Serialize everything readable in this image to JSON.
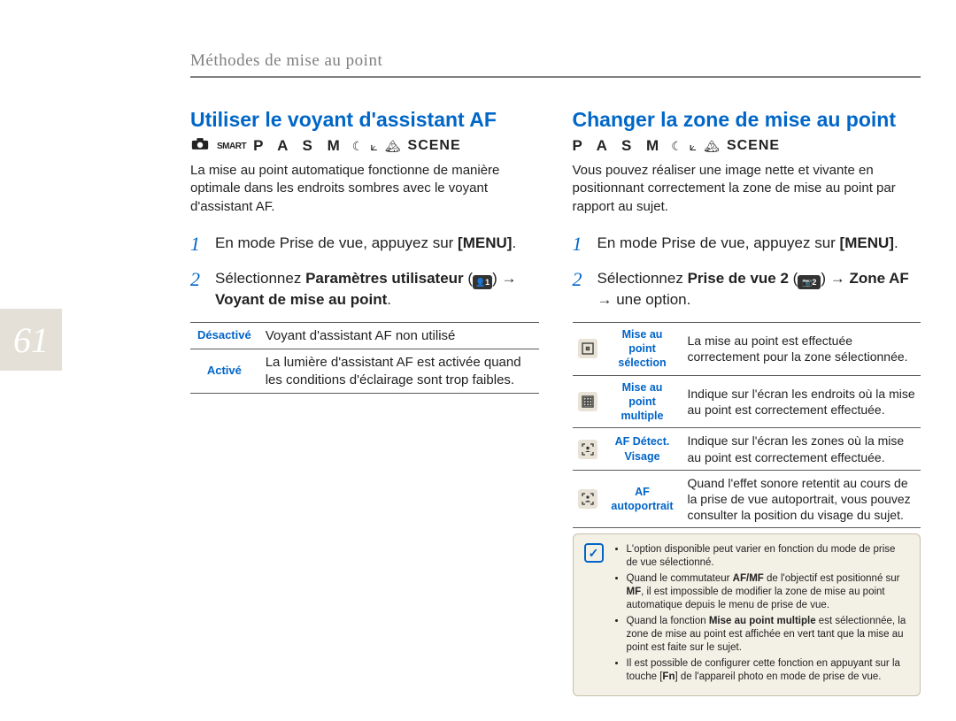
{
  "page_number": "61",
  "header_title": "Méthodes de mise au point",
  "left": {
    "title": "Utiliser le voyant d'assistant AF",
    "modes": {
      "smart": "SMART",
      "pasm": "P A S M",
      "scene": "SCENE"
    },
    "intro": "La mise au point automatique fonctionne de manière optimale dans les endroits sombres avec le voyant d'assistant AF.",
    "steps": [
      {
        "num": "1",
        "text_pre": "En mode Prise de vue, appuyez sur ",
        "menu": "[MENU]",
        "text_post": "."
      },
      {
        "num": "2",
        "text_pre": "Sélectionnez ",
        "bold1": "Paramètres utilisateur",
        "icon1": "1",
        "mid": " → ",
        "bold2": "Voyant de mise au point",
        "text_post": "."
      }
    ],
    "table": [
      {
        "opt": "Désactivé",
        "desc": "Voyant d'assistant AF non utilisé"
      },
      {
        "opt": "Activé",
        "desc": "La lumière d'assistant AF est activée quand les conditions d'éclairage sont trop faibles."
      }
    ]
  },
  "right": {
    "title": "Changer la zone de mise au point",
    "modes": {
      "pasm": "P A S M",
      "scene": "SCENE"
    },
    "intro": "Vous pouvez réaliser une image nette et vivante en positionnant correctement la zone de mise au point par rapport au sujet.",
    "steps": [
      {
        "num": "1",
        "text_pre": "En mode Prise de vue, appuyez sur ",
        "menu": "[MENU]",
        "text_post": "."
      },
      {
        "num": "2",
        "text_pre": "Sélectionnez ",
        "bold1": "Prise de vue 2",
        "icon1": "2",
        "mid": " → ",
        "bold2": "Zone AF",
        "text_post": " → une option."
      }
    ],
    "table2": [
      {
        "icon": "⊡",
        "label": "Mise au point sélection",
        "desc": "La mise au point est effectuée correctement pour la zone sélectionnée."
      },
      {
        "icon": "▦",
        "label": "Mise au point multiple",
        "desc": "Indique sur l'écran les endroits où la mise au point est correctement effectuée."
      },
      {
        "icon": "⌖",
        "label": "AF Détect. Visage",
        "desc": "Indique sur l'écran les zones où la mise au point est correctement effectuée."
      },
      {
        "icon": "⌖",
        "label": "AF autoportrait",
        "desc": "Quand l'effet sonore retentit au cours de la prise de vue autoportrait, vous pouvez consulter la position du visage du sujet."
      }
    ],
    "notes": [
      "L'option disponible peut varier en fonction du mode de prise de vue sélectionné.",
      "Quand le commutateur AF/MF de l'objectif est positionné sur MF, il est impossible de modifier la zone de mise au point automatique depuis le menu de prise de vue.",
      "Quand la fonction Mise au point multiple est sélectionnée, la zone de mise au point est affichée en vert tant que la mise au point est faite sur le sujet.",
      "Il est possible de configurer cette fonction en appuyant sur la touche [Fn] de l'appareil photo en mode de prise de vue."
    ]
  }
}
